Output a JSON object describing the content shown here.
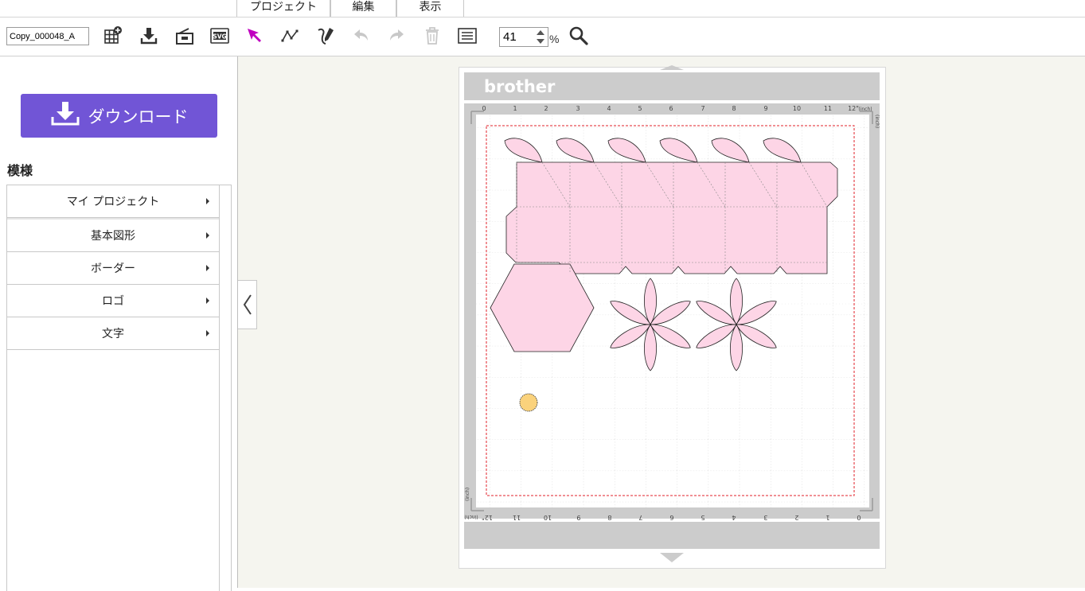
{
  "menu": {
    "tabs": [
      {
        "label": "プロジェクト"
      },
      {
        "label": "編集"
      },
      {
        "label": "表示"
      }
    ]
  },
  "toolbar": {
    "project_name": "Copy_000048_A",
    "zoom_value": "41",
    "zoom_unit": "%",
    "icons": [
      "add-pattern-icon",
      "import-icon",
      "scan-icon",
      "svg-import-icon",
      "select-arrow-icon",
      "node-edit-icon",
      "draw-pen-icon",
      "undo-icon",
      "redo-icon",
      "trash-icon",
      "list-icon",
      "zoom-icon"
    ]
  },
  "sidebar": {
    "download_label": "ダウンロード",
    "section_title": "模様",
    "items": [
      {
        "label": "マイ プロジェクト"
      },
      {
        "label": "基本図形"
      },
      {
        "label": "ボーダー"
      },
      {
        "label": "ロゴ"
      },
      {
        "label": "文字"
      }
    ]
  },
  "mat": {
    "brand": "brother",
    "top_ruler": [
      "0",
      "1",
      "2",
      "3",
      "4",
      "5",
      "6",
      "7",
      "8",
      "9",
      "10",
      "11",
      "12\""
    ],
    "top_unit": "(inch)",
    "bottom_ruler": [
      "12\"",
      "11",
      "10",
      "9",
      "8",
      "7",
      "6",
      "5",
      "4",
      "3",
      "2",
      "1",
      "0"
    ],
    "bottom_unit": "(inch)",
    "side_unit": "(inch)",
    "colors": {
      "shape_fill": "#fdd5e6",
      "circle_fill": "#fad27c",
      "mat_gray": "#cccccc",
      "cut_line": "#e0202a",
      "accent": "#7155d6",
      "select_tool": "#c000c0"
    }
  }
}
